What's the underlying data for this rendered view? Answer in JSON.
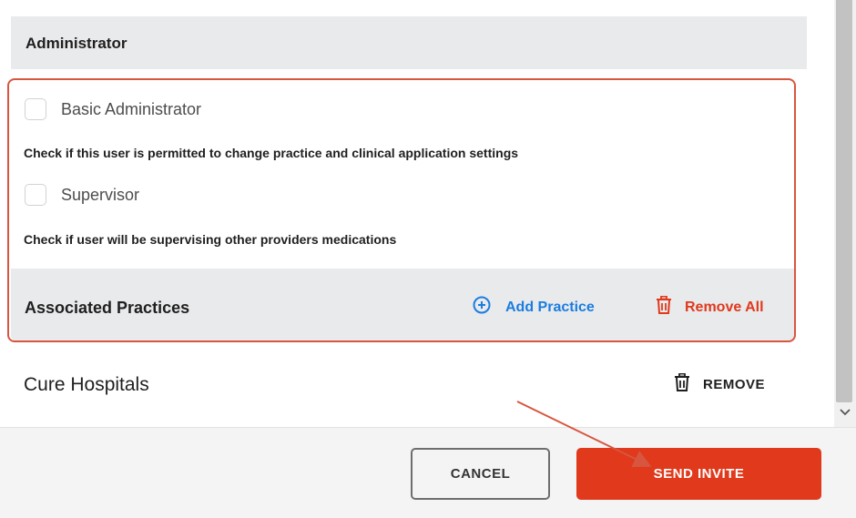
{
  "section": {
    "title": "Administrator"
  },
  "permissions": [
    {
      "label": "Basic Administrator",
      "checked": false,
      "help": "Check if this user is permitted to change practice and clinical application settings"
    },
    {
      "label": "Supervisor",
      "checked": false,
      "help": "Check if user will be supervising other providers medications"
    }
  ],
  "practices": {
    "title": "Associated Practices",
    "add_label": "Add Practice",
    "remove_all_label": "Remove All",
    "items": [
      {
        "name": "Cure Hospitals",
        "remove_label": "REMOVE"
      }
    ]
  },
  "footer": {
    "cancel_label": "CANCEL",
    "send_label": "SEND INVITE"
  },
  "colors": {
    "accent_red": "#e0391c",
    "link_blue": "#1a7de0",
    "highlight_border": "#d8553f",
    "header_bg": "#e9eaec"
  },
  "icons": {
    "add": "plus-circle-icon",
    "remove_all": "trash-icon",
    "remove": "trash-icon",
    "scroll_down": "chevron-down-icon"
  }
}
